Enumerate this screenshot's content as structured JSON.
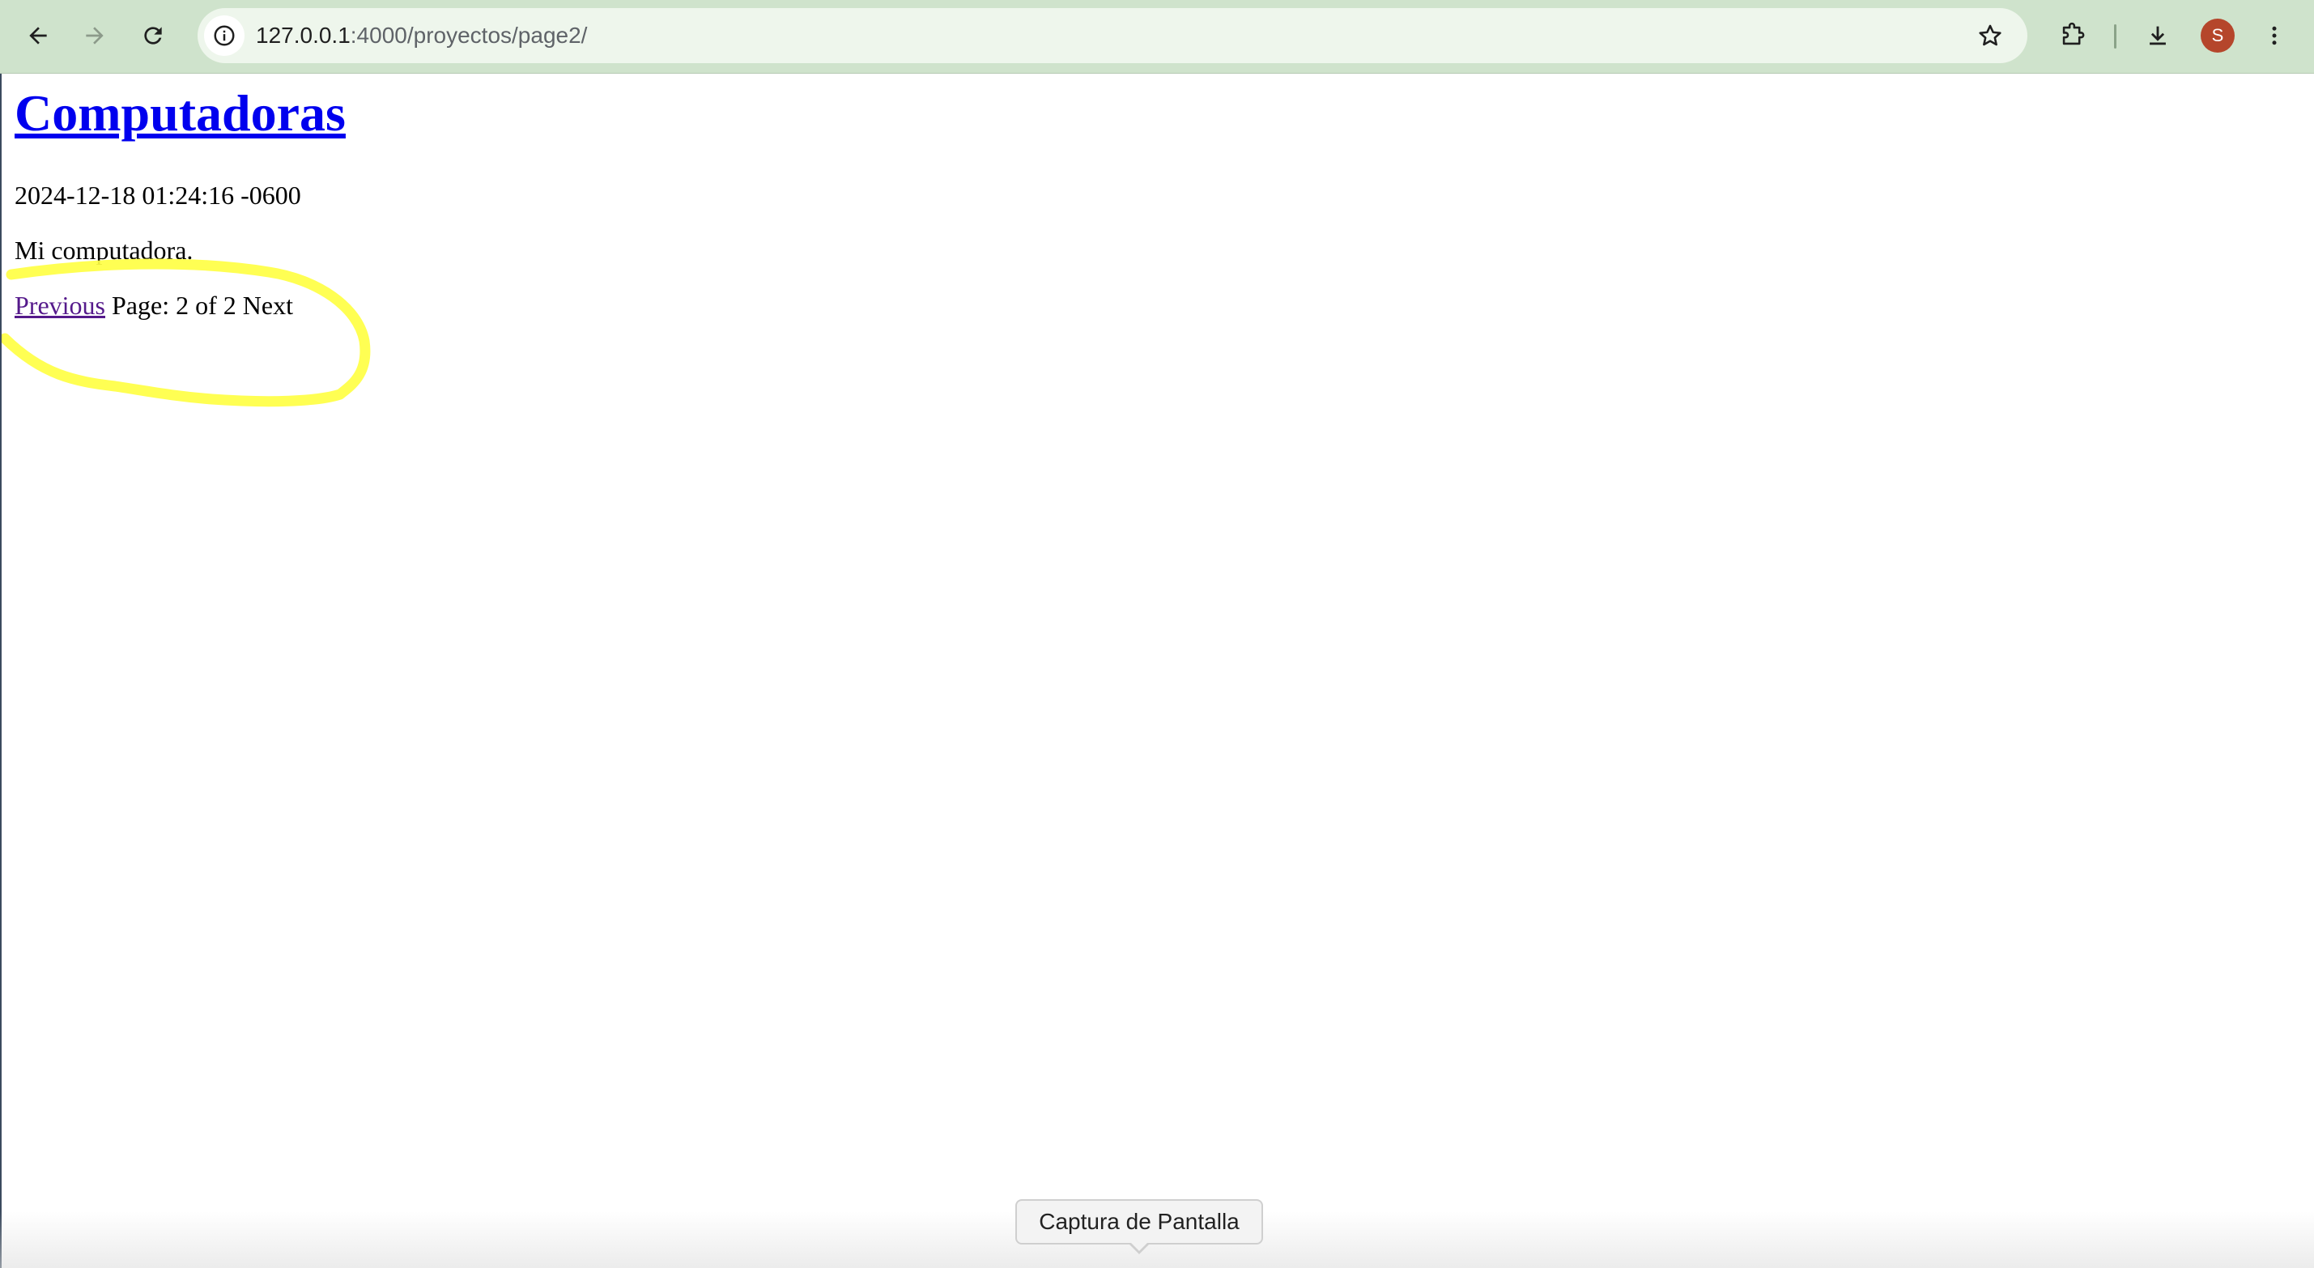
{
  "browser": {
    "url_host": "127.0.0.1",
    "url_rest": ":4000/proyectos/page2/",
    "profile_initial": "S",
    "icons": {
      "back": "arrow-left-icon",
      "forward": "arrow-right-icon",
      "reload": "reload-icon",
      "site_info": "info-icon",
      "bookmark": "star-icon",
      "extensions": "puzzle-icon",
      "downloads": "download-icon",
      "menu": "kebab-menu-icon"
    },
    "colors": {
      "toolbar": "#cfe3cc",
      "omnibox": "#eef6ec",
      "avatar": "#b5462b"
    }
  },
  "page": {
    "title": "Computadoras",
    "date": "2024-12-18 01:24:16 -0600",
    "excerpt": "Mi computadora.",
    "pagination": {
      "previous_label": "Previous",
      "page_text": "Page: 2 of 2",
      "next_label": "Next"
    },
    "annotation_color": "#ffff44"
  },
  "tooltip": {
    "text": "Captura de Pantalla"
  }
}
